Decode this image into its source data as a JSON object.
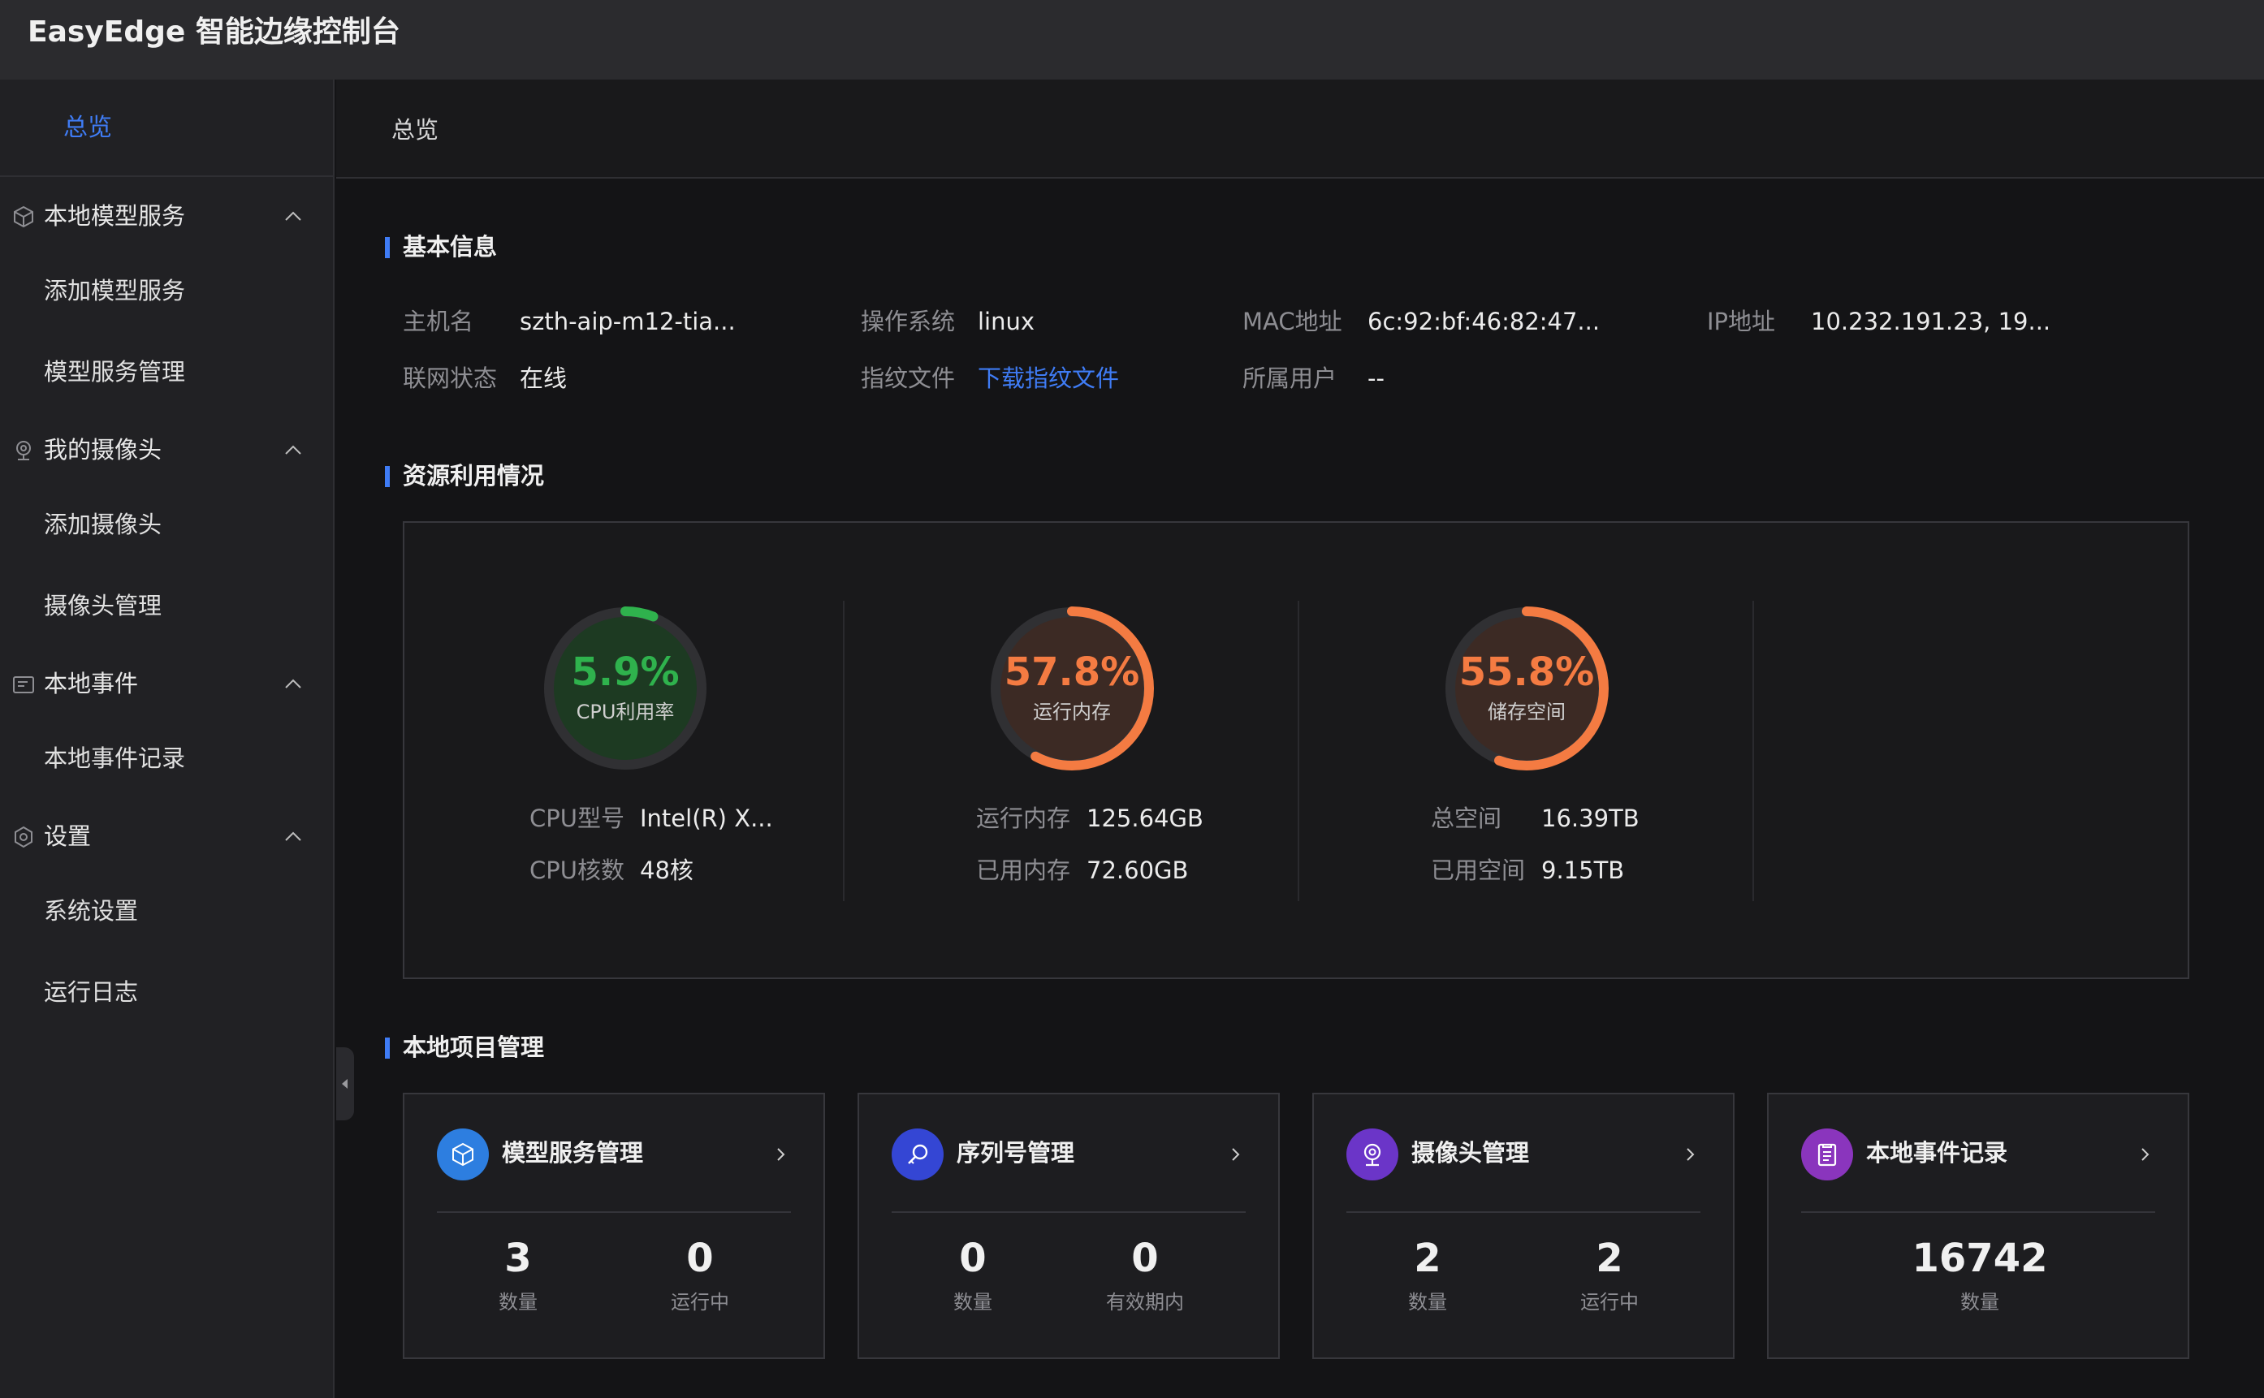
{
  "app": {
    "title": "EasyEdge 智能边缘控制台"
  },
  "sidebar": {
    "overview": "总览",
    "groups": [
      {
        "label": "本地模型服务",
        "icon": "cube-icon",
        "items": [
          "添加模型服务",
          "模型服务管理"
        ]
      },
      {
        "label": "我的摄像头",
        "icon": "camera-icon",
        "items": [
          "添加摄像头",
          "摄像头管理"
        ]
      },
      {
        "label": "本地事件",
        "icon": "event-icon",
        "items": [
          "本地事件记录"
        ]
      },
      {
        "label": "设置",
        "icon": "settings-icon",
        "items": [
          "系统设置",
          "运行日志"
        ]
      }
    ]
  },
  "breadcrumb": "总览",
  "basic_info": {
    "title": "基本信息",
    "hostname": {
      "label": "主机名",
      "value": "szth-aip-m12-tia..."
    },
    "os": {
      "label": "操作系统",
      "value": "linux"
    },
    "mac": {
      "label": "MAC地址",
      "value": "6c:92:bf:46:82:47..."
    },
    "ip": {
      "label": "IP地址",
      "value": "10.232.191.23, 19..."
    },
    "network": {
      "label": "联网状态",
      "value": "在线"
    },
    "fingerprint": {
      "label": "指纹文件",
      "value": "下载指纹文件"
    },
    "owner": {
      "label": "所属用户",
      "value": "--"
    }
  },
  "resources": {
    "title": "资源利用情况",
    "cpu": {
      "percent": "5.9%",
      "fraction": 0.059,
      "label": "CPU利用率",
      "color": "#2fb24d",
      "row1_k": "CPU型号",
      "row1_v": "Intel(R) X...",
      "row2_k": "CPU核数",
      "row2_v": "48核"
    },
    "memory": {
      "percent": "57.8%",
      "fraction": 0.578,
      "label": "运行内存",
      "color": "#f47b42",
      "row1_k": "运行内存",
      "row1_v": "125.64GB",
      "row2_k": "已用内存",
      "row2_v": "72.60GB"
    },
    "storage": {
      "percent": "55.8%",
      "fraction": 0.558,
      "label": "储存空间",
      "color": "#f47b42",
      "row1_k": "总空间",
      "row1_v": "16.39TB",
      "row2_k": "已用空间",
      "row2_v": "9.15TB"
    }
  },
  "projects": {
    "title": "本地项目管理",
    "cards": [
      {
        "title": "模型服务管理",
        "icon": "cube-icon",
        "color": "#2d7ee0",
        "stats": [
          {
            "num": "3",
            "label": "数量"
          },
          {
            "num": "0",
            "label": "运行中"
          }
        ]
      },
      {
        "title": "序列号管理",
        "icon": "search-key-icon",
        "color": "#3446d4",
        "stats": [
          {
            "num": "0",
            "label": "数量"
          },
          {
            "num": "0",
            "label": "有效期内"
          }
        ]
      },
      {
        "title": "摄像头管理",
        "icon": "camera-icon",
        "color": "#6b35c8",
        "stats": [
          {
            "num": "2",
            "label": "数量"
          },
          {
            "num": "2",
            "label": "运行中"
          }
        ]
      },
      {
        "title": "本地事件记录",
        "icon": "document-icon",
        "color": "#8a35bd",
        "stats": [
          {
            "num": "16742",
            "label": "数量"
          }
        ]
      }
    ]
  }
}
